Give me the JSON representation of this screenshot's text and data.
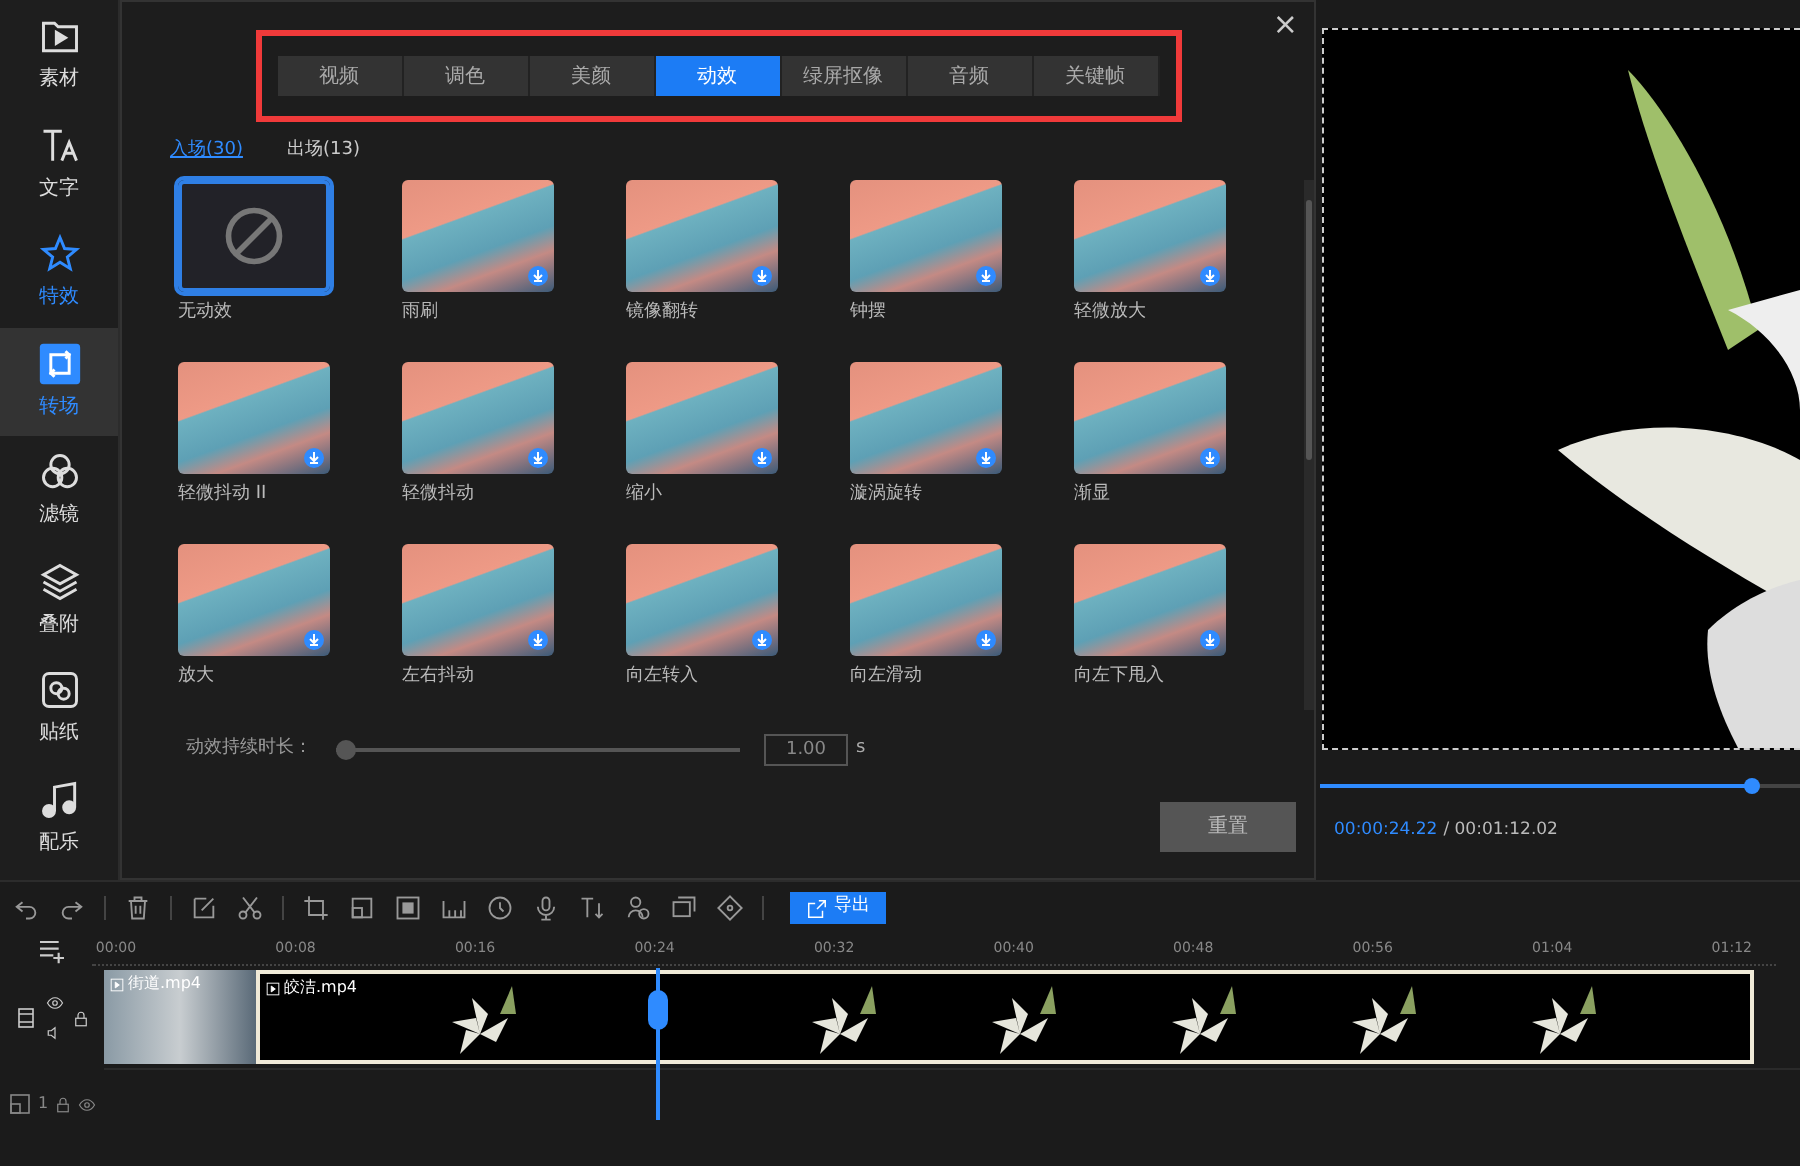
{
  "sidebar": {
    "items": [
      {
        "label": "素材",
        "selected": false,
        "highlighted": false
      },
      {
        "label": "文字",
        "selected": false,
        "highlighted": false
      },
      {
        "label": "特效",
        "selected": false,
        "highlighted": true
      },
      {
        "label": "转场",
        "selected": true,
        "highlighted": false
      },
      {
        "label": "滤镜",
        "selected": false,
        "highlighted": false
      },
      {
        "label": "叠附",
        "selected": false,
        "highlighted": false
      },
      {
        "label": "贴纸",
        "selected": false,
        "highlighted": false
      },
      {
        "label": "配乐",
        "selected": false,
        "highlighted": false
      }
    ]
  },
  "panel": {
    "tabs": [
      {
        "label": "视频",
        "selected": false
      },
      {
        "label": "调色",
        "selected": false
      },
      {
        "label": "美颜",
        "selected": false
      },
      {
        "label": "动效",
        "selected": true
      },
      {
        "label": "绿屏抠像",
        "selected": false
      },
      {
        "label": "音频",
        "selected": false
      },
      {
        "label": "关键帧",
        "selected": false
      }
    ],
    "close": "×",
    "subtabs": [
      {
        "label": "入场(30)",
        "selected": true
      },
      {
        "label": "出场(13)",
        "selected": false
      }
    ],
    "effects": [
      {
        "label": "无动效",
        "kind": "none",
        "selected": true
      },
      {
        "label": "雨刷",
        "kind": "download",
        "selected": false
      },
      {
        "label": "镜像翻转",
        "kind": "download",
        "selected": false
      },
      {
        "label": "钟摆",
        "kind": "download",
        "selected": false
      },
      {
        "label": "轻微放大",
        "kind": "download",
        "selected": false
      },
      {
        "label": "轻微抖动 II",
        "kind": "download",
        "selected": false
      },
      {
        "label": "轻微抖动",
        "kind": "download",
        "selected": false
      },
      {
        "label": "缩小",
        "kind": "download",
        "selected": false
      },
      {
        "label": "漩涡旋转",
        "kind": "download",
        "selected": false
      },
      {
        "label": "渐显",
        "kind": "download",
        "selected": false
      },
      {
        "label": "放大",
        "kind": "download",
        "selected": false
      },
      {
        "label": "左右抖动",
        "kind": "download",
        "selected": false
      },
      {
        "label": "向左转入",
        "kind": "download",
        "selected": false
      },
      {
        "label": "向左滑动",
        "kind": "download",
        "selected": false
      },
      {
        "label": "向左下甩入",
        "kind": "download",
        "selected": false
      }
    ],
    "duration": {
      "label": "动效持续时长：",
      "level": 0,
      "value": "1.00",
      "unit": "s"
    },
    "reset_button": "重置"
  },
  "preview": {
    "level": 0.9,
    "current_time": "00:00:24.22",
    "total_time": "/ 00:01:12.02"
  },
  "toolbar": {
    "export_button": "导出"
  },
  "timeline": {
    "ruler": [
      "00:00",
      "00:08",
      "00:16",
      "00:24",
      "00:32",
      "00:40",
      "00:48",
      "00:56",
      "01:04",
      "01:12"
    ],
    "track_number": "1",
    "clips": [
      {
        "label": "街道.mp4",
        "selected": false
      },
      {
        "label": "皎洁.mp4",
        "selected": true
      }
    ]
  }
}
